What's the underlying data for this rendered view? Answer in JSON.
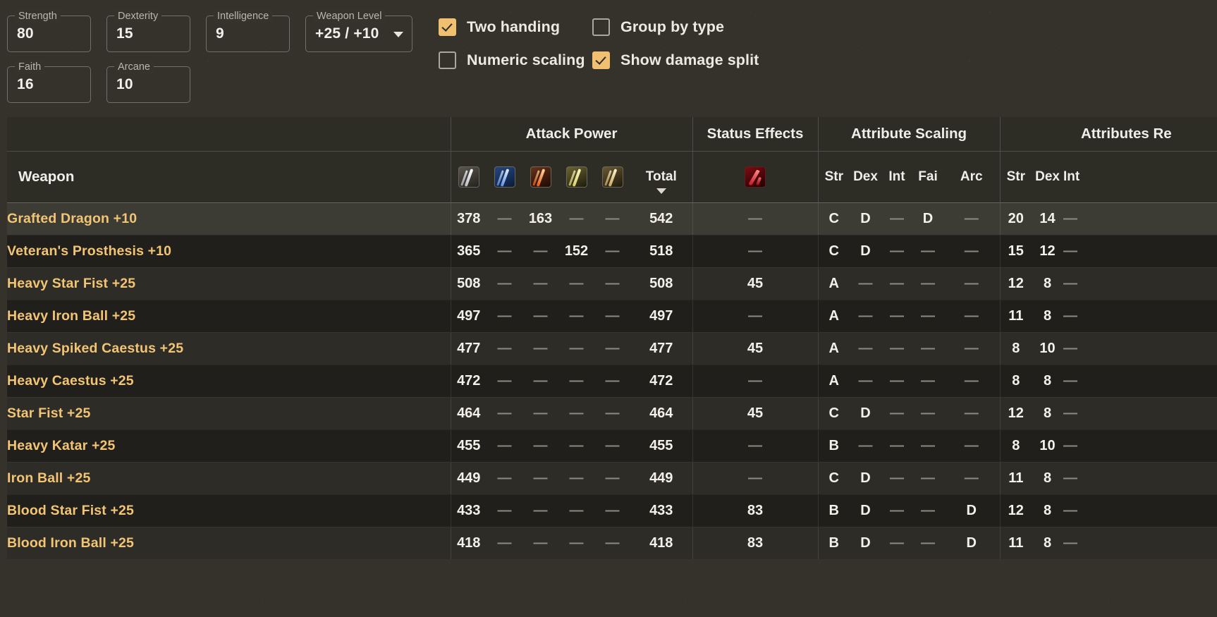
{
  "stats": [
    {
      "label": "Strength",
      "value": "80",
      "type": "number"
    },
    {
      "label": "Dexterity",
      "value": "15",
      "type": "number"
    },
    {
      "label": "Intelligence",
      "value": "9",
      "type": "number"
    },
    {
      "label": "Weapon Level",
      "value": "+25 / +10",
      "type": "select"
    },
    {
      "label": "Faith",
      "value": "16",
      "type": "number"
    },
    {
      "label": "Arcane",
      "value": "10",
      "type": "number"
    }
  ],
  "checkboxes": [
    {
      "label": "Two handing",
      "checked": true
    },
    {
      "label": "Group by type",
      "checked": false
    },
    {
      "label": "Numeric scaling",
      "checked": false
    },
    {
      "label": "Show damage split",
      "checked": true
    }
  ],
  "table": {
    "group_headers": [
      {
        "label": "",
        "span": 1
      },
      {
        "label": "Attack Power",
        "span": 6
      },
      {
        "label": "Status Effects",
        "span": 1
      },
      {
        "label": "Attribute Scaling",
        "span": 5
      },
      {
        "label": "Attributes Re",
        "span": 3
      }
    ],
    "weapon_header": "Weapon",
    "damage_icons": [
      "physical-damage-icon",
      "magic-damage-icon",
      "fire-damage-icon",
      "lightning-damage-icon",
      "holy-damage-icon"
    ],
    "total_header": "Total",
    "sort_indicator": "descending",
    "status_icon": "bleed-status-icon",
    "scaling_headers": [
      "Str",
      "Dex",
      "Int",
      "Fai",
      "Arc"
    ],
    "required_headers": [
      "Str",
      "Dex",
      "Int"
    ],
    "rows": [
      {
        "name": "Grafted Dragon +10",
        "phys": "378",
        "magic": "—",
        "fire": "163",
        "light": "—",
        "holy": "—",
        "total": "542",
        "status": "—",
        "s_str": "C",
        "s_dex": "D",
        "s_int": "—",
        "s_fai": "D",
        "s_arc": "—",
        "r_str": "20",
        "r_dex": "14",
        "r_int": "—",
        "hovered": true
      },
      {
        "name": "Veteran's Prosthesis +10",
        "phys": "365",
        "magic": "—",
        "fire": "—",
        "light": "152",
        "holy": "—",
        "total": "518",
        "status": "—",
        "s_str": "C",
        "s_dex": "D",
        "s_int": "—",
        "s_fai": "—",
        "s_arc": "—",
        "r_str": "15",
        "r_dex": "12",
        "r_int": "—",
        "hovered": false
      },
      {
        "name": "Heavy Star Fist +25",
        "phys": "508",
        "magic": "—",
        "fire": "—",
        "light": "—",
        "holy": "—",
        "total": "508",
        "status": "45",
        "s_str": "A",
        "s_dex": "—",
        "s_int": "—",
        "s_fai": "—",
        "s_arc": "—",
        "r_str": "12",
        "r_dex": "8",
        "r_int": "—",
        "hovered": false
      },
      {
        "name": "Heavy Iron Ball +25",
        "phys": "497",
        "magic": "—",
        "fire": "—",
        "light": "—",
        "holy": "—",
        "total": "497",
        "status": "—",
        "s_str": "A",
        "s_dex": "—",
        "s_int": "—",
        "s_fai": "—",
        "s_arc": "—",
        "r_str": "11",
        "r_dex": "8",
        "r_int": "—",
        "hovered": false
      },
      {
        "name": "Heavy Spiked Caestus +25",
        "phys": "477",
        "magic": "—",
        "fire": "—",
        "light": "—",
        "holy": "—",
        "total": "477",
        "status": "45",
        "s_str": "A",
        "s_dex": "—",
        "s_int": "—",
        "s_fai": "—",
        "s_arc": "—",
        "r_str": "8",
        "r_dex": "10",
        "r_int": "—",
        "hovered": false
      },
      {
        "name": "Heavy Caestus +25",
        "phys": "472",
        "magic": "—",
        "fire": "—",
        "light": "—",
        "holy": "—",
        "total": "472",
        "status": "—",
        "s_str": "A",
        "s_dex": "—",
        "s_int": "—",
        "s_fai": "—",
        "s_arc": "—",
        "r_str": "8",
        "r_dex": "8",
        "r_int": "—",
        "hovered": false
      },
      {
        "name": "Star Fist +25",
        "phys": "464",
        "magic": "—",
        "fire": "—",
        "light": "—",
        "holy": "—",
        "total": "464",
        "status": "45",
        "s_str": "C",
        "s_dex": "D",
        "s_int": "—",
        "s_fai": "—",
        "s_arc": "—",
        "r_str": "12",
        "r_dex": "8",
        "r_int": "—",
        "hovered": false
      },
      {
        "name": "Heavy Katar +25",
        "phys": "455",
        "magic": "—",
        "fire": "—",
        "light": "—",
        "holy": "—",
        "total": "455",
        "status": "—",
        "s_str": "B",
        "s_dex": "—",
        "s_int": "—",
        "s_fai": "—",
        "s_arc": "—",
        "r_str": "8",
        "r_dex": "10",
        "r_int": "—",
        "hovered": false
      },
      {
        "name": "Iron Ball +25",
        "phys": "449",
        "magic": "—",
        "fire": "—",
        "light": "—",
        "holy": "—",
        "total": "449",
        "status": "—",
        "s_str": "C",
        "s_dex": "D",
        "s_int": "—",
        "s_fai": "—",
        "s_arc": "—",
        "r_str": "11",
        "r_dex": "8",
        "r_int": "—",
        "hovered": false
      },
      {
        "name": "Blood Star Fist +25",
        "phys": "433",
        "magic": "—",
        "fire": "—",
        "light": "—",
        "holy": "—",
        "total": "433",
        "status": "83",
        "s_str": "B",
        "s_dex": "D",
        "s_int": "—",
        "s_fai": "—",
        "s_arc": "D",
        "r_str": "12",
        "r_dex": "8",
        "r_int": "—",
        "hovered": false
      },
      {
        "name": "Blood Iron Ball +25",
        "phys": "418",
        "magic": "—",
        "fire": "—",
        "light": "—",
        "holy": "—",
        "total": "418",
        "status": "83",
        "s_str": "B",
        "s_dex": "D",
        "s_int": "—",
        "s_fai": "—",
        "s_arc": "D",
        "r_str": "11",
        "r_dex": "8",
        "r_int": "—",
        "hovered": false
      }
    ]
  },
  "colors": {
    "background": "#34322a",
    "accent": "#f0c070",
    "weapon_name": "#f2c475",
    "row_odd": "#2d2c26",
    "row_even": "#201f1b",
    "row_hover": "#3c3b34"
  }
}
